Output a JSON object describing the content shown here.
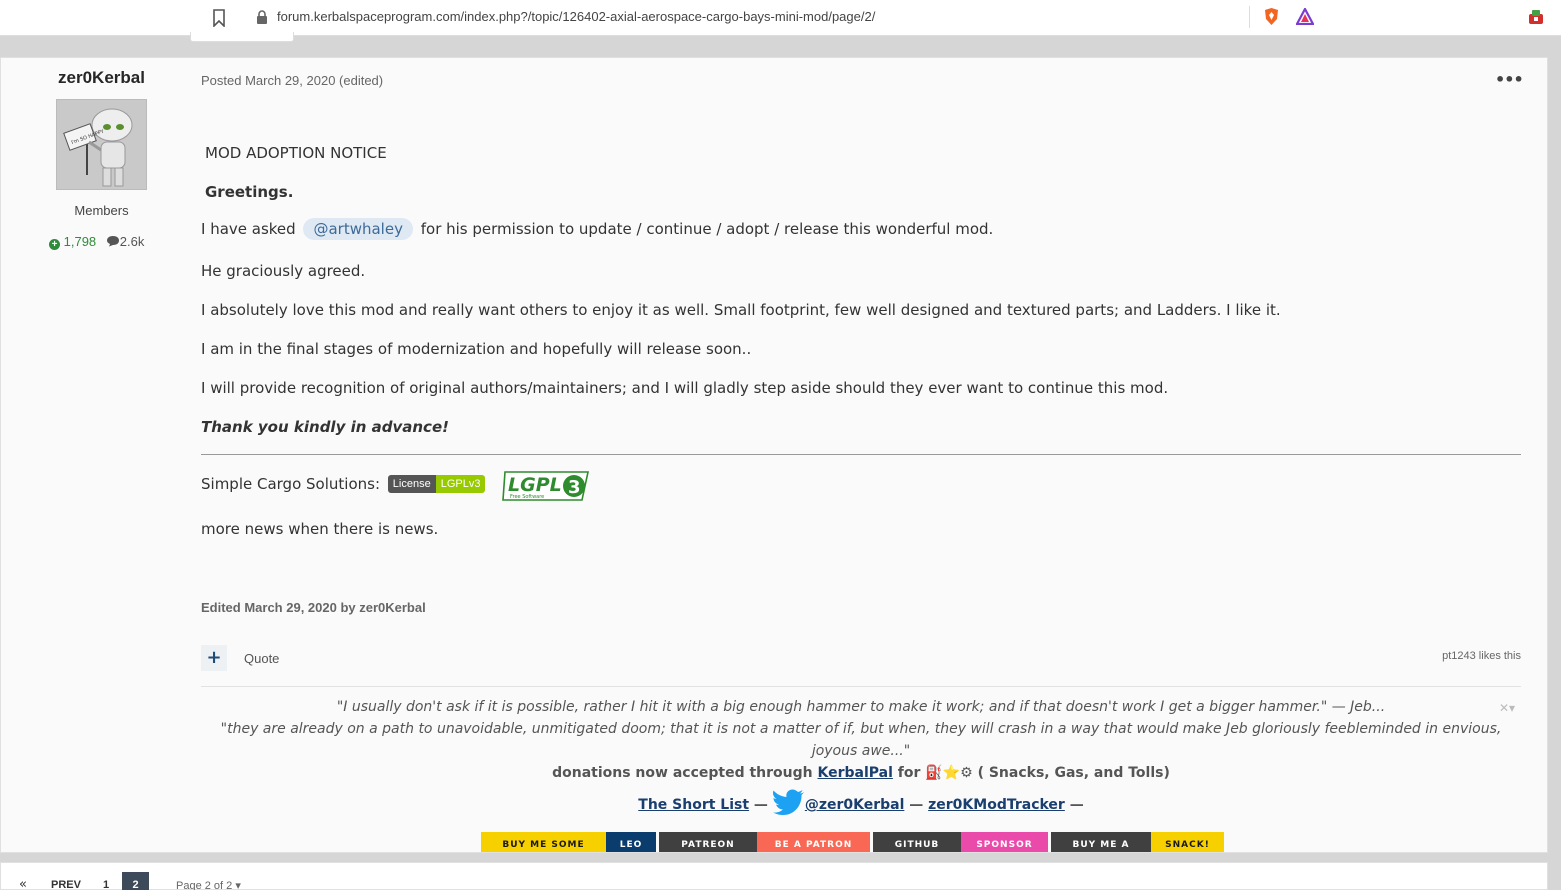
{
  "browser": {
    "url": "forum.kerbalspaceprogram.com/index.php?/topic/126402-axial-aerospace-cargo-bays-mini-mod/page/2/"
  },
  "author": {
    "name": "zer0Kerbal",
    "group": "Members",
    "reputation": "1,798",
    "posts": "2.6k",
    "avatar_sign": "I'm SO HAPPY"
  },
  "post": {
    "meta": "Posted March 29, 2020 (edited)",
    "more_label": "•••",
    "notice": "MOD ADOPTION NOTICE",
    "greeting": "Greetings.",
    "line1_before": "I have asked",
    "mention": "@artwhaley",
    "line1_after": "for his permission to update / continue / adopt / release this wonderful mod.",
    "line2": "He graciously agreed.",
    "line3": "I absolutely love this mod and really want others to enjoy it as well. Small footprint, few well designed and textured parts; and Ladders. I like it.",
    "line4": "I am in the final stages of modernization and hopefully will release soon..",
    "line5": "I will provide recognition of original authors/maintainers; and I will gladly step aside should they ever want to continue this mod.",
    "thanks": "Thank you kindly in advance!",
    "solutions_label": "Simple Cargo Solutions:",
    "badge_left": "License",
    "badge_right": "LGPLv3",
    "lgpl_logo_text": "LGPL",
    "lgpl_logo_sub": "Free Software",
    "news": "more news when there is news.",
    "edited": "Edited March 29, 2020 by zer0Kerbal",
    "quote_label": "Quote",
    "plus_label": "+",
    "likes": "pt1243 likes this"
  },
  "signature": {
    "quote1": "\"I usually don't ask if it is possible, rather I hit it with a big enough hammer to make it work; and if that doesn't work I get a bigger hammer.\"",
    "quote1_attr": " — Jeb...",
    "quote2a": "\"they are already on a path to unavoidable, unmitigated doom; that it is not a matter of if, but when, they will crash in a way that would make Jeb gloriously feebleminded in envious,",
    "quote2b": "joyous awe...\"",
    "donations_before": "donations now accepted through",
    "kerbalpal": "KerbalPal",
    "donations_for": "for",
    "donations_glyphs": "⛽⭐⚙",
    "donations_after": "( Snacks, Gas, and Tolls)",
    "shortlist": "The Short List",
    "dash1": " — ",
    "twitter": "@zer0Kerbal",
    "dash2": "  — ",
    "tracker": "zer0KModTracker",
    "dash3": " —",
    "close": "✕▾"
  },
  "buttons": [
    {
      "label": "BUY ME SOME",
      "bg": "#f7d000",
      "fg": "#1a1a1a",
      "w": 125
    },
    {
      "label": "LEO",
      "bg": "#0b3c6e",
      "fg": "#ffffff",
      "w": 50
    },
    {
      "label": "PATREON",
      "bg": "#404040",
      "fg": "#ffffff",
      "w": 98
    },
    {
      "label": "BE A PATRON",
      "bg": "#f96854",
      "fg": "#ffffff",
      "w": 113
    },
    {
      "label": "GITHUB",
      "bg": "#404040",
      "fg": "#ffffff",
      "w": 88
    },
    {
      "label": "SPONSOR",
      "bg": "#ea4aaa",
      "fg": "#ffffff",
      "w": 87
    },
    {
      "label": "BUY ME A",
      "bg": "#404040",
      "fg": "#ffffff",
      "w": 100
    },
    {
      "label": "SNACK!",
      "bg": "#f7d000",
      "fg": "#1a1a1a",
      "w": 73
    }
  ],
  "pagination": {
    "first": "«",
    "prev": "PREV",
    "page1": "1",
    "page2": "2",
    "page_of": "Page 2 of 2 ▾"
  }
}
